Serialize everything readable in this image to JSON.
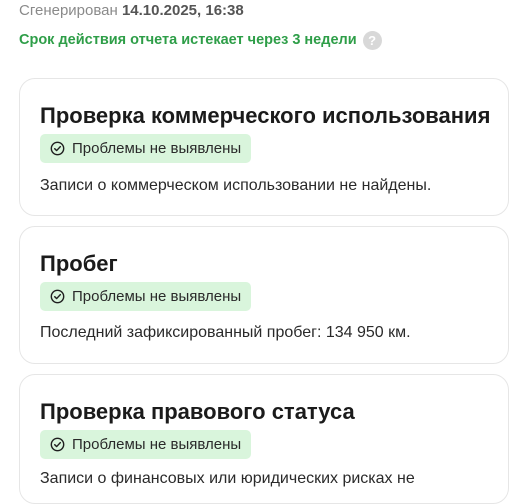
{
  "header": {
    "generated_label": "Сгенерирован",
    "generated_date": "14.10.2025, 16:38",
    "expiry_text": "Срок действия отчета истекает через 3 недели",
    "help_symbol": "?"
  },
  "cards": [
    {
      "title": "Проверка коммерческого использования",
      "badge": "Проблемы не выявлены",
      "text": "Записи о коммерческом использовании не найдены."
    },
    {
      "title": "Пробег",
      "badge": "Проблемы не выявлены",
      "text": "Последний зафиксированный пробег: 134 950 км."
    },
    {
      "title": "Проверка правового статуса",
      "badge": "Проблемы не выявлены",
      "text": "Записи о финансовых или юридических рисках не"
    }
  ],
  "colors": {
    "success_text": "#2e9e48",
    "badge_bg": "#d9f5dc",
    "card_border": "#e6e6e6"
  },
  "icons": {
    "check": "check-circle-icon",
    "help": "question-circle-icon"
  }
}
